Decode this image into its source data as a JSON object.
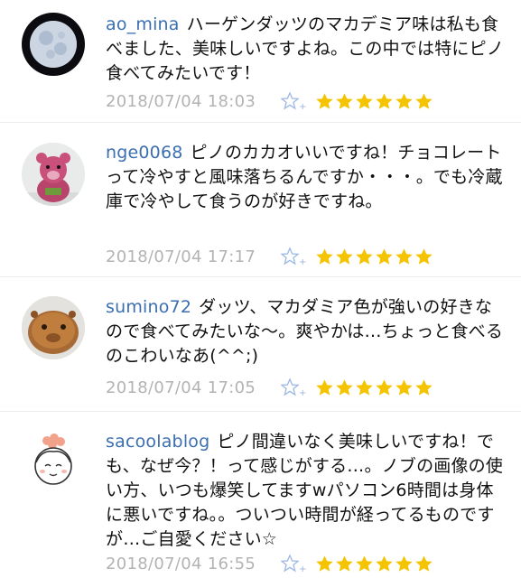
{
  "comments": [
    {
      "username": "ao_mina",
      "text": "ハーゲンダッツのマカデミア味は私も食べました、美味しいですよね。この中では特にピノ食べてみたいです！",
      "date": "2018/07/04 18:03",
      "star_count": 6,
      "avatar_icon": "moon-avatar"
    },
    {
      "username": "nge0068",
      "text": "ピノのカカオいいですね！チョコレートって冷やすと風味落ちるんですか・・・。でも冷蔵庫で冷やして食うのが好きですね。",
      "date": "2018/07/04 17:17",
      "star_count": 6,
      "avatar_icon": "pink-bear-avatar"
    },
    {
      "username": "sumino72",
      "text": "ダッツ、マカダミア色が強いの好きなので食べてみたいな〜。爽やかは…ちょっと食べるのこわいなあ(^^;)",
      "date": "2018/07/04 17:05",
      "star_count": 6,
      "avatar_icon": "capybara-avatar"
    },
    {
      "username": "sacoolablog",
      "text": "ピノ間違いなく美味しいですね！でも、なぜ今？！って感じがする…。ノブの画像の使い方、いつも爆笑してますwパソコン6時間は身体に悪いですね。。ついつい時間が経ってるものですが…ご自愛ください☆",
      "date": "2018/07/04 16:55",
      "star_count": 6,
      "avatar_icon": "girl-drawing-avatar"
    }
  ],
  "colors": {
    "username": "#3b6fb2",
    "date": "#b3b3b3",
    "star": "#f5c400",
    "add_star": "#9bb7e3"
  }
}
